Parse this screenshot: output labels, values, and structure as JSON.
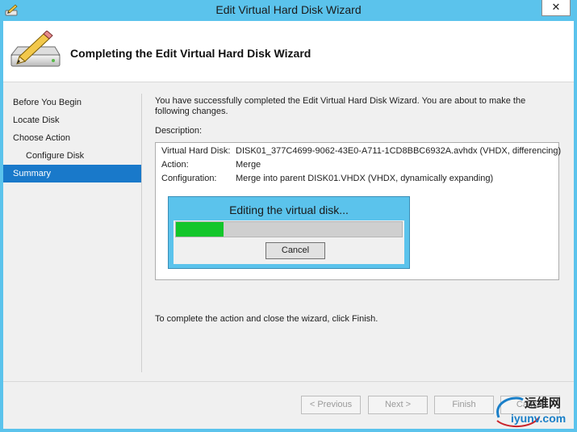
{
  "window": {
    "title": "Edit Virtual Hard Disk Wizard",
    "close_glyph": "✕"
  },
  "header": {
    "title": "Completing the Edit Virtual Hard Disk Wizard",
    "icon": "disk-pencil-icon"
  },
  "nav": {
    "items": [
      {
        "label": "Before You Begin"
      },
      {
        "label": "Locate Disk"
      },
      {
        "label": "Choose Action"
      },
      {
        "label": "Configure Disk"
      },
      {
        "label": "Summary"
      }
    ],
    "active_index": 4
  },
  "main": {
    "intro": "You have successfully completed the Edit Virtual Hard Disk Wizard. You are about to make the following changes.",
    "description_label": "Description:",
    "details": [
      {
        "key": "Virtual Hard Disk:",
        "value": "DISK01_377C4699-9062-43E0-A711-1CD8BBC6932A.avhdx (VHDX, differencing)"
      },
      {
        "key": "Action:",
        "value": "Merge"
      },
      {
        "key": "Configuration:",
        "value": "Merge into parent DISK01.VHDX (VHDX, dynamically expanding)"
      }
    ],
    "finish_note": "To complete the action and close the wizard, click Finish."
  },
  "progress": {
    "title": "Editing the virtual disk...",
    "fraction": 0.21,
    "cancel_label": "Cancel",
    "fill_color": "#13c62a"
  },
  "footer": {
    "previous_label": "< Previous",
    "next_label": "Next >",
    "finish_label": "Finish",
    "cancel_label": "Cancel"
  },
  "watermark": {
    "line1": "运维网",
    "line2": "iyunv.com"
  },
  "colors": {
    "frame": "#5bc3ec",
    "selection": "#1979ca"
  }
}
